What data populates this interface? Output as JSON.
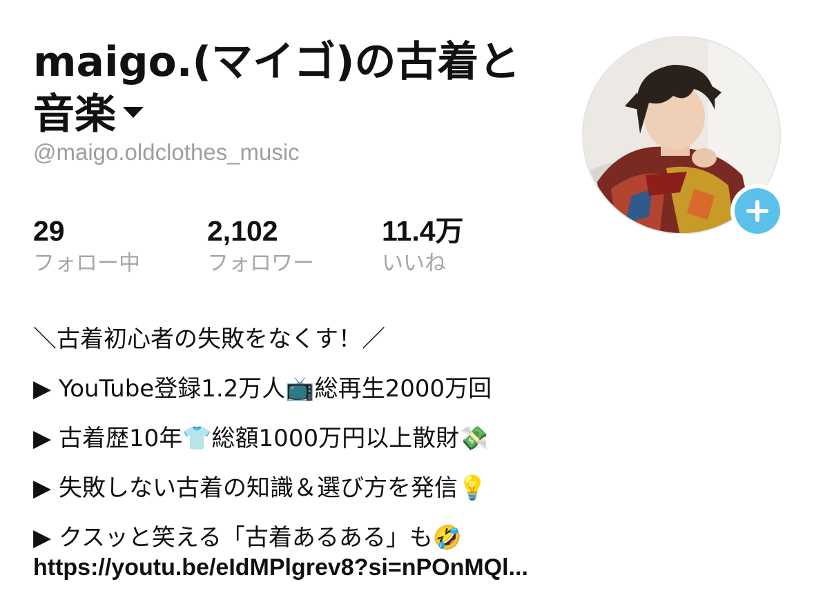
{
  "profile": {
    "display_name": "maigo.(マイゴ)の古着と音楽",
    "handle": "@maigo.oldclothes_music",
    "accent_color": "#5bc1ea"
  },
  "avatar": {
    "alt": "profile photo",
    "add_icon": "plus-icon"
  },
  "stats": [
    {
      "value": "29",
      "label": "フォロー中"
    },
    {
      "value": "2,102",
      "label": "フォロワー"
    },
    {
      "value": "11.4万",
      "label": "いいね"
    }
  ],
  "bio": {
    "lines": [
      "＼古着初心者の失敗をなくす！／",
      "▶ YouTube登録1.2万人📺総再生2000万回",
      "▶ 古着歴10年👕総額1000万円以上散財💸",
      "▶ 失敗しない古着の知識＆選び方を発信💡",
      "▶ クスッと笑える「古着あるある」も🤣"
    ],
    "link": "https://youtu.be/eIdMPlgrev8?si=nPOnMQl..."
  }
}
